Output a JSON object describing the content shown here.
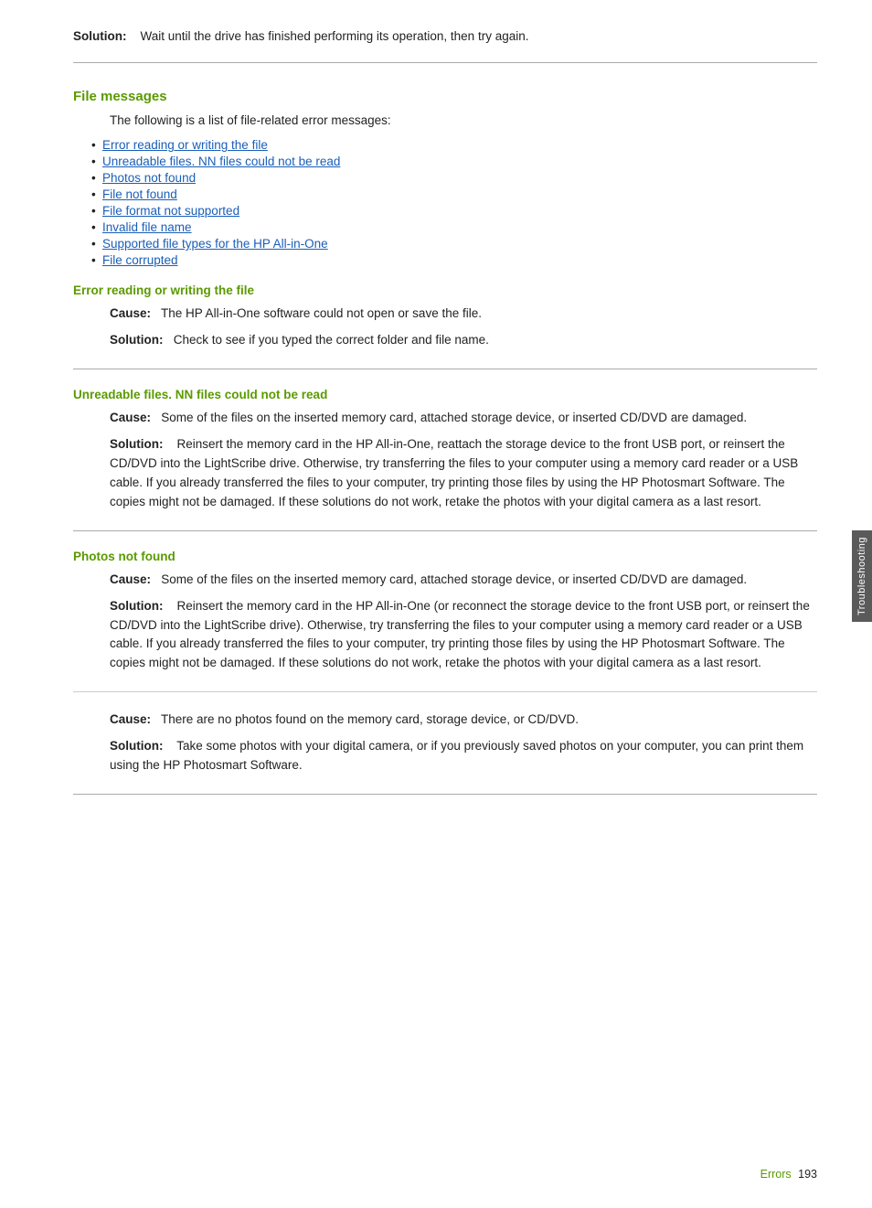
{
  "page": {
    "top_solution": {
      "label": "Solution:",
      "text": "Wait until the drive has finished performing its operation, then try again."
    },
    "file_messages": {
      "heading": "File messages",
      "intro": "The following is a list of file-related error messages:",
      "links": [
        "Error reading or writing the file",
        "Unreadable files. NN files could not be read",
        "Photos not found",
        "File not found",
        "File format not supported",
        "Invalid file name",
        "Supported file types for the HP All-in-One",
        "File corrupted"
      ]
    },
    "subsections": [
      {
        "id": "error-reading",
        "heading": "Error reading or writing the file",
        "items": [
          {
            "label": "Cause:",
            "text": "The HP All-in-One software could not open or save the file."
          },
          {
            "label": "Solution:",
            "text": "Check to see if you typed the correct folder and file name."
          }
        ]
      },
      {
        "id": "unreadable-files",
        "heading": "Unreadable files. NN files could not be read",
        "items": [
          {
            "label": "Cause:",
            "text": "Some of the files on the inserted memory card, attached storage device, or inserted CD/DVD are damaged."
          },
          {
            "label": "Solution:",
            "text": "Reinsert the memory card in the HP All-in-One, reattach the storage device to the front USB port, or reinsert the CD/DVD into the LightScribe drive. Otherwise, try transferring the files to your computer using a memory card reader or a USB cable. If you already transferred the files to your computer, try printing those files by using the HP Photosmart Software. The copies might not be damaged. If these solutions do not work, retake the photos with your digital camera as a last resort."
          }
        ]
      },
      {
        "id": "photos-not-found",
        "heading": "Photos not found",
        "items": [
          {
            "label": "Cause:",
            "text": "Some of the files on the inserted memory card, attached storage device, or inserted CD/DVD are damaged."
          },
          {
            "label": "Solution:",
            "text": "Reinsert the memory card in the HP All-in-One (or reconnect the storage device to the front USB port, or reinsert the CD/DVD into the LightScribe drive). Otherwise, try transferring the files to your computer using a memory card reader or a USB cable. If you already transferred the files to your computer, try printing those files by using the HP Photosmart Software. The copies might not be damaged. If these solutions do not work, retake the photos with your digital camera as a last resort."
          },
          {
            "label": "Cause:",
            "text": "There are no photos found on the memory card, storage device, or CD/DVD."
          },
          {
            "label": "Solution:",
            "text": "Take some photos with your digital camera, or if you previously saved photos on your computer, you can print them using the HP Photosmart Software."
          }
        ]
      }
    ],
    "right_tab": "Troubleshooting",
    "footer": {
      "label": "Errors",
      "page_number": "193"
    }
  }
}
